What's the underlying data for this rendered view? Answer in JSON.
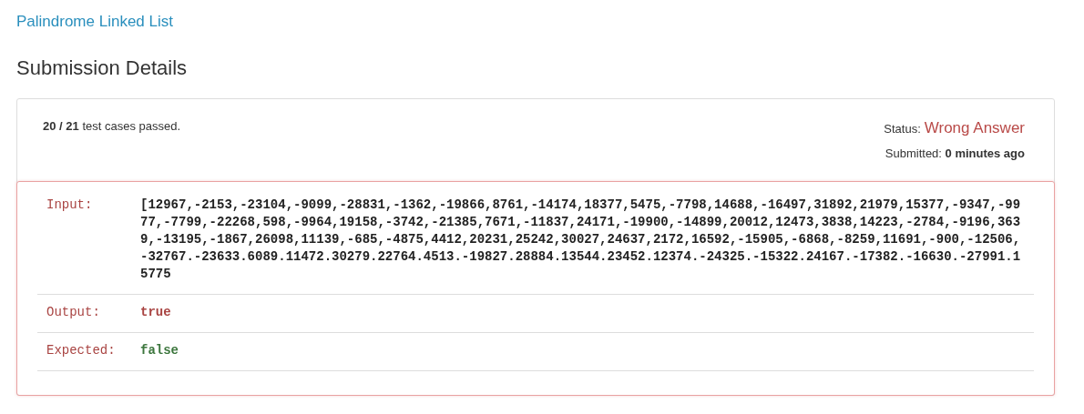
{
  "problem_link": "Palindrome Linked List",
  "heading": "Submission Details",
  "summary": {
    "passed": "**20 / 21** test cases passed.",
    "status_label": "Status:",
    "status": "Wrong Answer",
    "submitted": "Submitted: **0 minutes ago**"
  },
  "details": [
    {
      "kind": "input",
      "label": "Input:",
      "value": "[12967,-2153,-23104,-9099,-28831,-1362,-19866,8761,-14174,18377,5475,-7798,14688,-16497,31892,21979,15377,-9347,-9977,-7799,-22268,598,-9964,19158,-3742,-21385,7671,-11837,24171,-19900,-14899,20012,12473,3838,14223,-2784,-9196,3639,-13195,-1867,26098,11139,-685,-4875,4412,20231,25242,30027,24637,2172,16592,-15905,-6868,-8259,11691,-900,-12506,-32767.-23633.6089.11472.30279.22764.4513.-19827.28884.13544.23452.12374.-24325.-15322.24167.-17382.-16630.-27991.15775"
    },
    {
      "kind": "output",
      "label": "Output:",
      "value": "true"
    },
    {
      "kind": "expected",
      "label": "Expected:",
      "value": "false"
    }
  ]
}
